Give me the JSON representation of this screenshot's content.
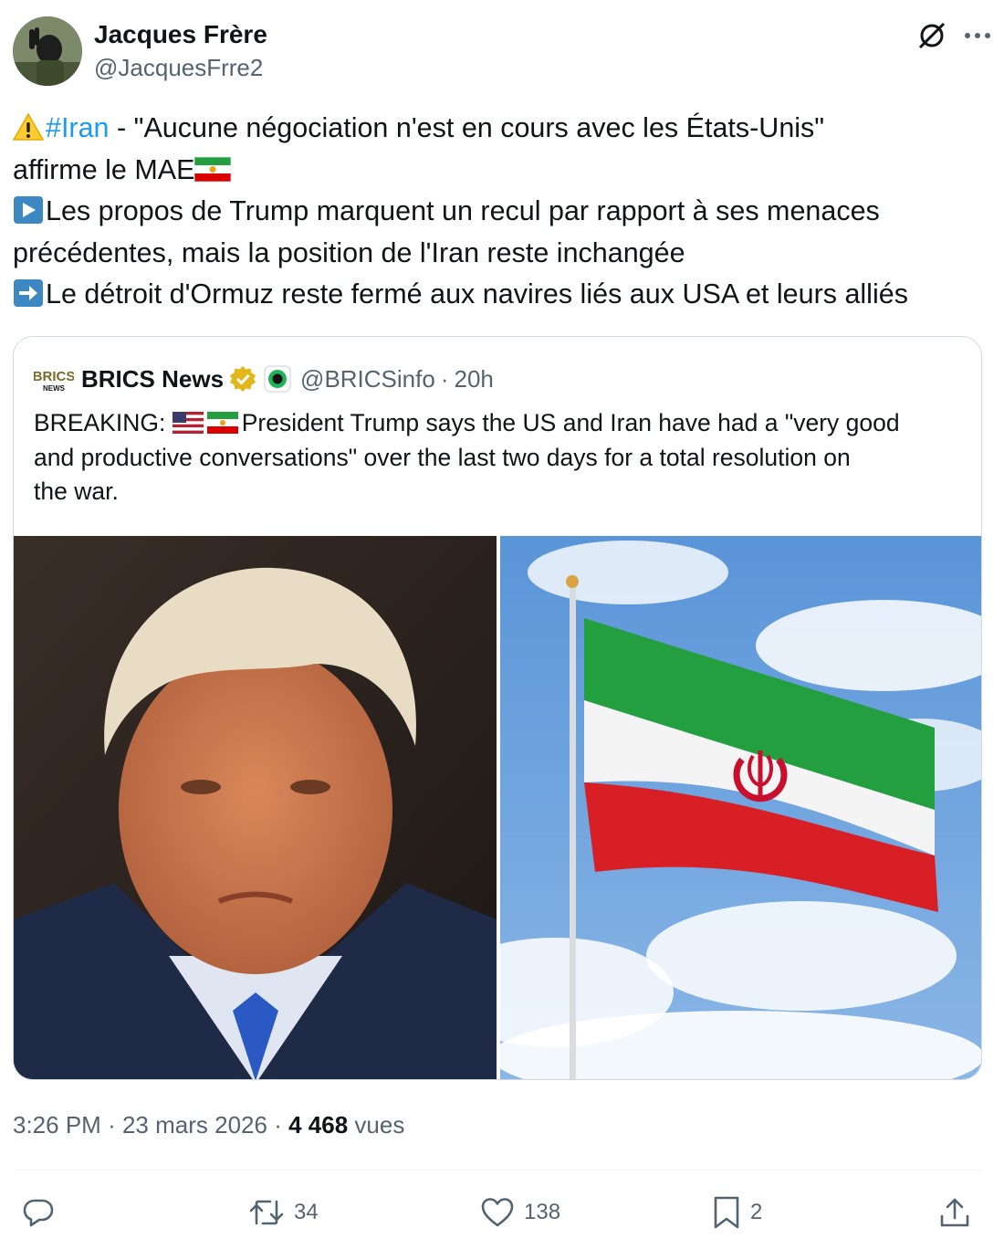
{
  "author": {
    "display_name": "Jacques Frère",
    "handle": "@JacquesFrre2"
  },
  "tweet": {
    "lines": [
      {
        "hashtag": "#Iran",
        "text": " - \"Aucune négociation n'est en cours avec les États-Unis\""
      },
      {
        "text": "affirme le MAE"
      },
      {
        "text": "Les propos de Trump marquent un recul par rapport à ses menaces"
      },
      {
        "text": "précédentes, mais la position de l'Iran reste inchangée"
      },
      {
        "text": "Le détroit d'Ormuz reste fermé aux navires liés aux USA et leurs alliés"
      }
    ]
  },
  "quote": {
    "display_name": "BRICS News",
    "handle": "@BRICSinfo",
    "separator": "·",
    "time": "20h",
    "logo_text_top": "BRICS",
    "logo_text_bottom": "NEWS",
    "text_prefix": "BREAKING:",
    "text_line1": "President Trump says the US and Iran have had a \"very good",
    "text_line2": "and productive conversations\" over the last two days for a total resolution on",
    "text_line3": "the war."
  },
  "meta": {
    "time": "3:26 PM",
    "sep1": "·",
    "date": "23 mars 2026",
    "sep2": "·",
    "views_count": "4 468",
    "views_label": "vues"
  },
  "actions": {
    "replies": "",
    "retweets": "34",
    "likes": "138",
    "bookmarks": "2"
  },
  "icons": {
    "warning": "warning-icon",
    "play": "play-button-icon",
    "arrow": "right-arrow-icon"
  },
  "colors": {
    "link": "#1d9bf0",
    "secondary_text": "#536471",
    "primary_text": "#0f1419",
    "border": "#cfd9de",
    "verified_gold": "#e2b719"
  }
}
